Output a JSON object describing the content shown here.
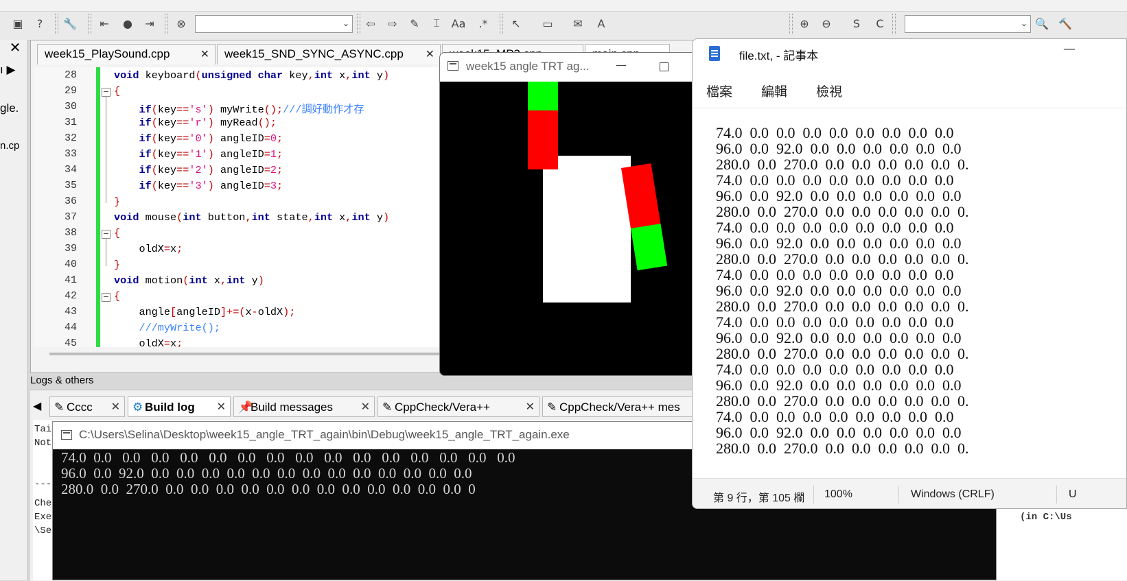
{
  "editor": {
    "tabs": [
      {
        "label": "week15_PlaySound.cpp"
      },
      {
        "label": "week15_SND_SYNC_ASYNC.cpp"
      },
      {
        "label": "week15_MP3.cpp"
      },
      {
        "label": "main.cpp"
      }
    ],
    "lines": [
      {
        "n": "28",
        "html": "<span class=\"kw\">void</span> keyboard<span class=\"op\">(</span><span class=\"kw\">unsigned char</span> key<span class=\"op\">,</span><span class=\"kw\">int</span> x<span class=\"op\">,</span><span class=\"kw\">int</span> y<span class=\"op\">)</span>"
      },
      {
        "n": "29",
        "html": "<span class=\"op\">{</span>"
      },
      {
        "n": "30",
        "html": "    <span class=\"kw\">if</span><span class=\"op\">(</span>key<span class=\"op\">==</span><span class=\"nm\">'s'</span><span class=\"op\">)</span> myWrite<span class=\"op\">();</span><span class=\"cm\">///調好動作才存</span>"
      },
      {
        "n": "31",
        "html": "    <span class=\"kw\">if</span><span class=\"op\">(</span>key<span class=\"op\">==</span><span class=\"nm\">'r'</span><span class=\"op\">)</span> myRead<span class=\"op\">();</span>"
      },
      {
        "n": "32",
        "html": "    <span class=\"kw\">if</span><span class=\"op\">(</span>key<span class=\"op\">==</span><span class=\"nm\">'0'</span><span class=\"op\">)</span> angleID<span class=\"op\">=</span><span class=\"nm\">0</span><span class=\"op\">;</span>"
      },
      {
        "n": "33",
        "html": "    <span class=\"kw\">if</span><span class=\"op\">(</span>key<span class=\"op\">==</span><span class=\"nm\">'1'</span><span class=\"op\">)</span> angleID<span class=\"op\">=</span><span class=\"nm\">1</span><span class=\"op\">;</span>"
      },
      {
        "n": "34",
        "html": "    <span class=\"kw\">if</span><span class=\"op\">(</span>key<span class=\"op\">==</span><span class=\"nm\">'2'</span><span class=\"op\">)</span> angleID<span class=\"op\">=</span><span class=\"nm\">2</span><span class=\"op\">;</span>"
      },
      {
        "n": "35",
        "html": "    <span class=\"kw\">if</span><span class=\"op\">(</span>key<span class=\"op\">==</span><span class=\"nm\">'3'</span><span class=\"op\">)</span> angleID<span class=\"op\">=</span><span class=\"nm\">3</span><span class=\"op\">;</span>"
      },
      {
        "n": "36",
        "html": "<span class=\"op\">}</span>"
      },
      {
        "n": "37",
        "html": "<span class=\"kw\">void</span> mouse<span class=\"op\">(</span><span class=\"kw\">int</span> button<span class=\"op\">,</span><span class=\"kw\">int</span> state<span class=\"op\">,</span><span class=\"kw\">int</span> x<span class=\"op\">,</span><span class=\"kw\">int</span> y<span class=\"op\">)</span>"
      },
      {
        "n": "38",
        "html": "<span class=\"op\">{</span>"
      },
      {
        "n": "39",
        "html": "    oldX<span class=\"op\">=</span>x<span class=\"op\">;</span>"
      },
      {
        "n": "40",
        "html": "<span class=\"op\">}</span>"
      },
      {
        "n": "41",
        "html": "<span class=\"kw\">void</span> motion<span class=\"op\">(</span><span class=\"kw\">int</span> x<span class=\"op\">,</span><span class=\"kw\">int</span> y<span class=\"op\">)</span>"
      },
      {
        "n": "42",
        "html": "<span class=\"op\">{</span>"
      },
      {
        "n": "43",
        "html": "    angle<span class=\"op\">[</span>angleID<span class=\"op\">]+=(</span>x<span class=\"op\">-</span>oldX<span class=\"op\">);</span>"
      },
      {
        "n": "44",
        "html": "    <span class=\"cm\">///myWrite();</span>"
      },
      {
        "n": "45",
        "html": "    oldX<span class=\"op\">=</span>x<span class=\"op\">;</span>"
      }
    ]
  },
  "left_panel": {
    "close": "✕",
    "frags": [
      "ı ▶",
      "gle.",
      "n.cp"
    ]
  },
  "logs": {
    "title": "Logs & others",
    "tabs": [
      {
        "label": "Cccc",
        "icon": "✎"
      },
      {
        "label": "Build log",
        "icon": "⚙"
      },
      {
        "label": "Build messages",
        "icon": "📌"
      },
      {
        "label": "CppCheck/Vera++",
        "icon": "✎"
      },
      {
        "label": "CppCheck/Vera++ mes",
        "icon": "✎"
      }
    ],
    "frags": [
      "Tai",
      "Not",
      "---",
      "Che",
      "Exe",
      "\\Se"
    ],
    "right_frag": "(in C:\\Us"
  },
  "console": {
    "title": "C:\\Users\\Selina\\Desktop\\week15_angle_TRT_again\\bin\\Debug\\week15_angle_TRT_again.exe",
    "lines": [
      "74.0  0.0   0.0   0.0   0.0   0.0   0.0   0.0   0.0   0.0   0.0   0.0   0.0   0.0   0.0   0.0",
      "96.0  0.0  92.0  0.0  0.0  0.0  0.0  0.0  0.0  0.0  0.0  0.0  0.0  0.0  0.0  0.0",
      "280.0  0.0  270.0  0.0  0.0  0.0  0.0  0.0  0.0  0.0  0.0  0.0  0.0  0.0  0.0  0"
    ]
  },
  "glut": {
    "title": "week15 angle TRT ag...",
    "min": "—",
    "colors": {
      "body": "#ffffff",
      "upper": "#ff0000",
      "lower": "#00ff00",
      "bg": "#000000"
    }
  },
  "notepad": {
    "title": "file.txt, - 記事本",
    "min": "—",
    "menu": [
      "檔案",
      "編輯",
      "檢視"
    ],
    "lines": [
      "74.0  0.0  0.0  0.0  0.0  0.0  0.0  0.0  0.0",
      "96.0  0.0  92.0  0.0  0.0  0.0  0.0  0.0  0.0",
      "280.0  0.0  270.0  0.0  0.0  0.0  0.0  0.0  0.",
      "74.0  0.0  0.0  0.0  0.0  0.0  0.0  0.0  0.0",
      "96.0  0.0  92.0  0.0  0.0  0.0  0.0  0.0  0.0",
      "280.0  0.0  270.0  0.0  0.0  0.0  0.0  0.0  0.",
      "74.0  0.0  0.0  0.0  0.0  0.0  0.0  0.0  0.0",
      "96.0  0.0  92.0  0.0  0.0  0.0  0.0  0.0  0.0",
      "280.0  0.0  270.0  0.0  0.0  0.0  0.0  0.0  0.",
      "74.0  0.0  0.0  0.0  0.0  0.0  0.0  0.0  0.0",
      "96.0  0.0  92.0  0.0  0.0  0.0  0.0  0.0  0.0",
      "280.0  0.0  270.0  0.0  0.0  0.0  0.0  0.0  0.",
      "74.0  0.0  0.0  0.0  0.0  0.0  0.0  0.0  0.0",
      "96.0  0.0  92.0  0.0  0.0  0.0  0.0  0.0  0.0",
      "280.0  0.0  270.0  0.0  0.0  0.0  0.0  0.0  0.",
      "74.0  0.0  0.0  0.0  0.0  0.0  0.0  0.0  0.0",
      "96.0  0.0  92.0  0.0  0.0  0.0  0.0  0.0  0.0",
      "280.0  0.0  270.0  0.0  0.0  0.0  0.0  0.0  0.",
      "74.0  0.0  0.0  0.0  0.0  0.0  0.0  0.0  0.0",
      "96.0  0.0  92.0  0.0  0.0  0.0  0.0  0.0  0.0",
      "280.0  0.0  270.0  0.0  0.0  0.0  0.0  0.0  0."
    ],
    "status": {
      "position": "第 9 行，第 105 欄",
      "zoom": "100%",
      "eol": "Windows (CRLF)",
      "enc": "U"
    }
  },
  "toolbar": {
    "icons": [
      {
        "name": "debug-window-icon",
        "glyph": "▣"
      },
      {
        "name": "help-icon",
        "glyph": "?"
      },
      {
        "name": "wrench-icon",
        "glyph": "🔧"
      },
      {
        "name": "jump-back-icon",
        "glyph": "⇤"
      },
      {
        "name": "bookmark-dot-icon",
        "glyph": "●"
      },
      {
        "name": "jump-forward-icon",
        "glyph": "⇥"
      },
      {
        "name": "clear-icon",
        "glyph": "⊗"
      },
      {
        "name": "arrow-left-icon",
        "glyph": "⇦"
      },
      {
        "name": "arrow-right-icon",
        "glyph": "⇨"
      },
      {
        "name": "highlight-icon",
        "glyph": "✎"
      },
      {
        "name": "selected-text-icon",
        "glyph": "⌶"
      },
      {
        "name": "match-case-icon",
        "glyph": "Aa"
      },
      {
        "name": "regex-icon",
        "glyph": ".*"
      },
      {
        "name": "pointer-icon",
        "glyph": "↖"
      },
      {
        "name": "block-icon",
        "glyph": "▭"
      },
      {
        "name": "email-icon",
        "glyph": "✉"
      },
      {
        "name": "text-frame-icon",
        "glyph": "A"
      },
      {
        "name": "zoom-in-icon",
        "glyph": "⊕"
      },
      {
        "name": "zoom-out-icon",
        "glyph": "⊖"
      },
      {
        "name": "s-icon",
        "glyph": "S"
      },
      {
        "name": "c-icon",
        "glyph": "C"
      },
      {
        "name": "search-icon",
        "glyph": "🔍"
      },
      {
        "name": "tools-icon",
        "glyph": "🔨"
      }
    ]
  }
}
